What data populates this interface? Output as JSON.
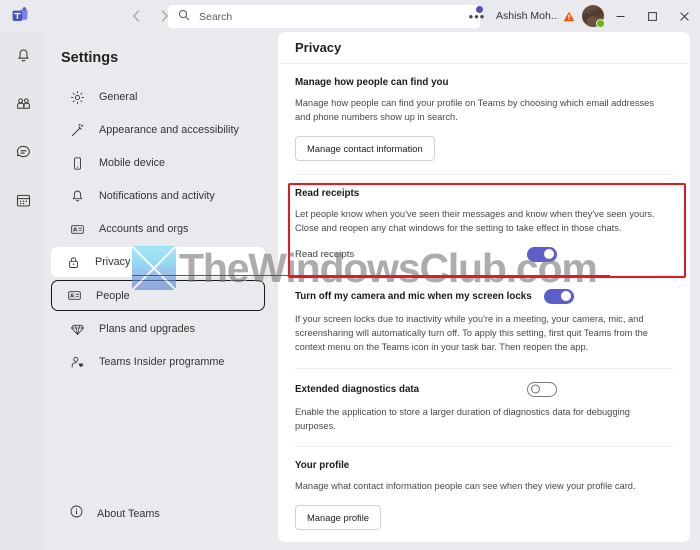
{
  "titlebar": {
    "logo_icon": "teams-logo-icon",
    "back_icon": "chevron-left-icon",
    "forward_icon": "chevron-right-icon",
    "search_icon": "search-icon",
    "search_placeholder": "Search",
    "search_value": "",
    "more_label": "•••",
    "user_name": "Ashish Moh...",
    "warning_icon": "warning-triangle-icon",
    "presence": "available",
    "minimize_label": "—",
    "maximize_label": "▢",
    "close_label": "✕"
  },
  "rail": {
    "items": [
      {
        "icon": "bell-icon",
        "name": "activity"
      },
      {
        "icon": "people-icon",
        "name": "teams"
      },
      {
        "icon": "chat-icon",
        "name": "chat"
      },
      {
        "icon": "calendar-icon",
        "name": "calendar"
      }
    ]
  },
  "sidebar": {
    "title": "Settings",
    "items": [
      {
        "label": "General",
        "icon": "gear-icon",
        "state": "normal"
      },
      {
        "label": "Appearance and accessibility",
        "icon": "magic-wand-icon",
        "state": "normal"
      },
      {
        "label": "Mobile device",
        "icon": "phone-icon",
        "state": "normal"
      },
      {
        "label": "Notifications and activity",
        "icon": "bell-icon",
        "state": "normal"
      },
      {
        "label": "Accounts and orgs",
        "icon": "id-card-icon",
        "state": "normal"
      },
      {
        "label": "Privacy",
        "icon": "lock-icon",
        "state": "selected"
      },
      {
        "label": "People",
        "icon": "id-card-icon",
        "state": "focused"
      },
      {
        "label": "Plans and upgrades",
        "icon": "diamond-icon",
        "state": "normal"
      },
      {
        "label": "Teams Insider programme",
        "icon": "person-heart-icon",
        "state": "normal"
      }
    ],
    "about": {
      "label": "About Teams",
      "icon": "info-icon"
    }
  },
  "panel": {
    "title": "Privacy",
    "sections": [
      {
        "heading": "Manage how people can find you",
        "description": "Manage how people can find your profile on Teams by choosing which email addresses and phone numbers show up in search.",
        "button": "Manage contact information"
      },
      {
        "heading": "Read receipts",
        "description": "Let people know when you've seen their messages and know when they've seen yours. Close and reopen any chat windows for the setting to take effect in those chats.",
        "toggle_label": "Read receipts",
        "toggle_state": "on"
      },
      {
        "heading": "Turn off my camera and mic when my screen locks",
        "description": "If your screen locks due to inactivity while you're in a meeting, your camera, mic, and screensharing will automatically turn off. To apply this setting, first quit Teams from the context menu on the Teams icon in your task bar. Then reopen the app.",
        "toggle_state": "on"
      },
      {
        "heading": "Extended diagnostics data",
        "description": "Enable the application to store a larger duration of diagnostics data for debugging purposes.",
        "toggle_state": "off"
      },
      {
        "heading": "Your profile",
        "description": "Manage what contact information people can see when they view your profile card.",
        "button": "Manage profile"
      }
    ]
  },
  "annotation": {
    "highlight_color": "#e01c21",
    "highlight_target": "Read receipts"
  },
  "watermark": {
    "text": "TheWindowsClub.com",
    "logo_icon": "windowsclub-x-logo-icon"
  },
  "colors": {
    "accent": "#5b5fc7",
    "highlight": "#e01c21",
    "presence_available": "#6bb700",
    "app_bg": "#e8eaed",
    "panel_bg": "#ffffff"
  }
}
